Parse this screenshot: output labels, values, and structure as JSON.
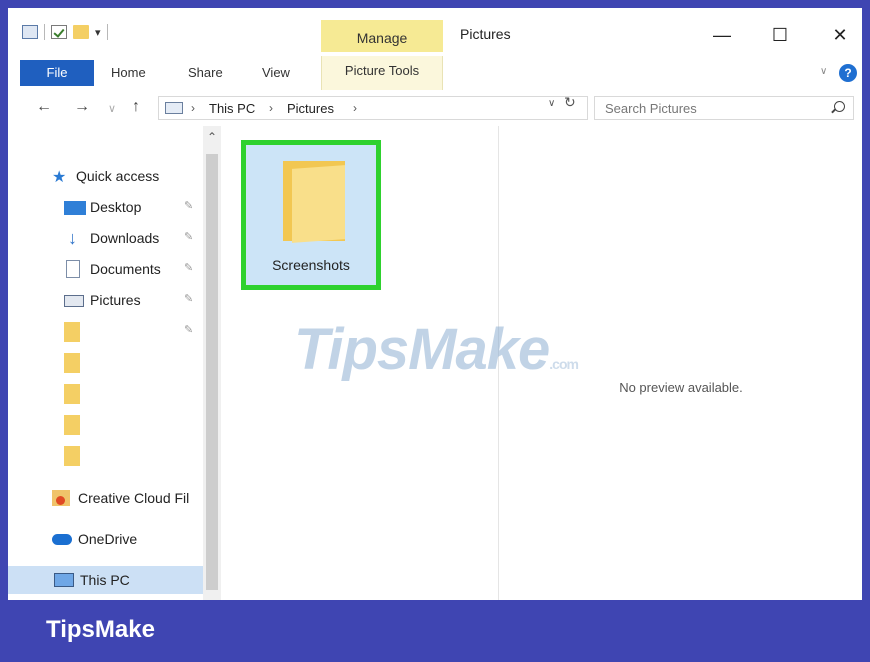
{
  "window": {
    "title": "Pictures",
    "contextual_tab_group": "Manage",
    "minimize_glyph": "—",
    "maximize_glyph": "☐",
    "close_glyph": "✕"
  },
  "ribbon": {
    "tabs": [
      "File",
      "Home",
      "Share",
      "View",
      "Picture Tools"
    ],
    "help_glyph": "?"
  },
  "address": {
    "crumbs": [
      "This PC",
      "Pictures"
    ],
    "separator": "›"
  },
  "search": {
    "placeholder": "Search Pictures"
  },
  "sidebar": {
    "items": [
      {
        "label": "Quick access",
        "icon": "star-icon"
      },
      {
        "label": "Desktop",
        "icon": "desktop-icon",
        "pinned": true
      },
      {
        "label": "Downloads",
        "icon": "download-arrow-icon",
        "pinned": true
      },
      {
        "label": "Documents",
        "icon": "document-icon",
        "pinned": true
      },
      {
        "label": "Pictures",
        "icon": "pictures-icon",
        "pinned": true
      },
      {
        "label": "",
        "icon": "folder-icon",
        "pinned": true
      },
      {
        "label": "",
        "icon": "folder-icon"
      },
      {
        "label": "",
        "icon": "folder-icon"
      },
      {
        "label": "",
        "icon": "folder-icon"
      },
      {
        "label": "",
        "icon": "folder-icon"
      },
      {
        "label": "Creative Cloud Fil",
        "icon": "creative-cloud-icon"
      },
      {
        "label": "OneDrive",
        "icon": "cloud-icon"
      },
      {
        "label": "This PC",
        "icon": "computer-icon",
        "selected": true
      }
    ]
  },
  "content": {
    "folders": [
      {
        "label": "Screenshots",
        "highlighted": true
      }
    ]
  },
  "preview": {
    "message": "No preview available."
  },
  "watermark": {
    "text": "TipsMake",
    "suffix": ".com"
  },
  "footer": {
    "brand": "TipsMake"
  },
  "colors": {
    "frame_background": "#3f45b2",
    "file_tab": "#1f5fbf",
    "highlight_border": "#2ed12e",
    "manage_tab": "#f6ea94",
    "folder": "#f2c752",
    "selection": "#cce0f5"
  }
}
